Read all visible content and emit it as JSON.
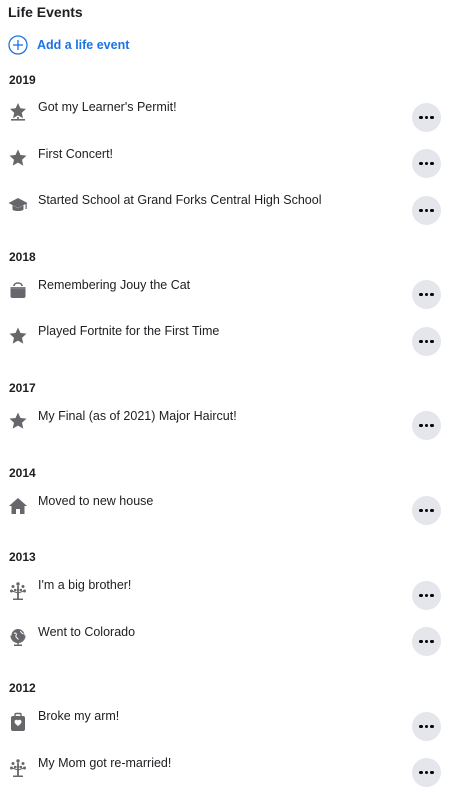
{
  "header": {
    "title": "Life Events",
    "add_label": "Add a life event"
  },
  "years": [
    "2019",
    "2018",
    "2017",
    "2014",
    "2013",
    "2012"
  ],
  "events": [
    {
      "year": "2019",
      "icon": "star-pin-icon",
      "label": "Got my Learner's Permit!"
    },
    {
      "year": "2019",
      "icon": "star-icon",
      "label": "First Concert!"
    },
    {
      "year": "2019",
      "icon": "graduation-cap-icon",
      "label": "Started School at Grand Forks Central High School"
    },
    {
      "year": "2018",
      "icon": "pet-carrier-icon",
      "label": "Remembering Jouy the Cat"
    },
    {
      "year": "2018",
      "icon": "star-icon",
      "label": "Played Fortnite for the First Time"
    },
    {
      "year": "2017",
      "icon": "star-icon",
      "label": "My Final (as of 2021) Major Haircut!"
    },
    {
      "year": "2014",
      "icon": "house-icon",
      "label": "Moved to new house"
    },
    {
      "year": "2013",
      "icon": "family-tree-icon",
      "label": "I'm a big brother!"
    },
    {
      "year": "2013",
      "icon": "globe-icon",
      "label": "Went to Colorado"
    },
    {
      "year": "2012",
      "icon": "medical-kit-icon",
      "label": "Broke my arm!"
    },
    {
      "year": "2012",
      "icon": "family-tree-icon",
      "label": "My Mom got re-married!"
    }
  ],
  "colors": {
    "accent": "#1b74e4",
    "icon": "#65676b",
    "more_bg": "#e4e6eb"
  }
}
